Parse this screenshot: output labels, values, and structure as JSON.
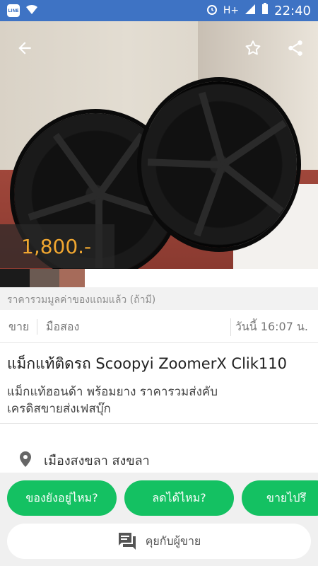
{
  "status_bar": {
    "app_badge": "LINE",
    "network": "H+",
    "time": "22:40"
  },
  "listing": {
    "price": "1,800.-",
    "price_note": "ราคารวมมูลค่าของแถมแล้ว (ถ้ามี)",
    "type": "ขาย",
    "condition": "มือสอง",
    "posted": "วันนี้ 16:07 น.",
    "title": "แม็กแท้ติดรถ Scoopyi ZoomerX Clik110",
    "description": "แม็กแท้ฮอนด้า  พร้อมยาง ราคารวมส่งคับ\nเครดิสขายส่งเฟสบุ๊ก",
    "location": "เมืองสงขลา สงขลา"
  },
  "quick_replies": [
    {
      "label": "ของยังอยู่ไหม?"
    },
    {
      "label": "ลดได้ไหม?"
    },
    {
      "label": "ขายไปรึ"
    }
  ],
  "chat": {
    "label": "คุยกับผู้ขาย"
  },
  "colors": {
    "status_bar": "#3e73c4",
    "price": "#f0a630",
    "chip": "#14c162"
  }
}
